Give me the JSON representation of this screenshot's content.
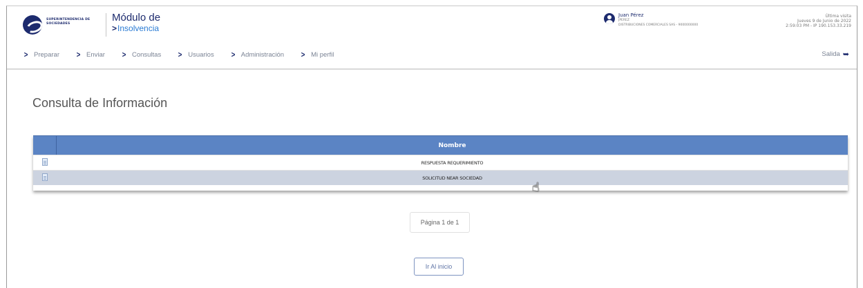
{
  "header": {
    "org_name": "SUPERINTENDENCIA DE SOCIEDADES",
    "module_title": "Módulo de",
    "module_subtitle": "Insolvencia",
    "user": {
      "name": "Juan Pérez",
      "role": "JPEREZ",
      "company": "DISTRIBUCIONES COMERCIALES SAS - 9000000000"
    },
    "last_visit": {
      "title": "Última visita",
      "date": "Jueves 9 de Junio de 2022",
      "time_ip": "2:59:03 PM - IP 190.153.33.219"
    }
  },
  "nav": {
    "items": [
      {
        "label": "Preparar",
        "icon": "chevron-right-icon"
      },
      {
        "label": "Enviar",
        "icon": "chevron-right-icon"
      },
      {
        "label": "Consultas",
        "icon": "chevron-right-icon"
      },
      {
        "label": "Usuarios",
        "icon": "chevron-right-icon"
      },
      {
        "label": "Administración",
        "icon": "chevron-right-icon"
      },
      {
        "label": "Mi perfil",
        "icon": "chevron-right-icon"
      }
    ],
    "logout_label": "Salida",
    "logout_icon": "sign-out-icon"
  },
  "main": {
    "page_title": "Consulta de Información",
    "table": {
      "header_name": "Nombre",
      "rows": [
        {
          "name": "RESPUESTA REQUERIMIENTO",
          "icon": "document-icon"
        },
        {
          "name": "SOLICITUD NEAR SOCIEDAD",
          "icon": "document-icon"
        }
      ]
    },
    "pager_text": "Página 1 de 1",
    "home_button": "Ir Al inicio"
  },
  "colors": {
    "brand_navy": "#1d2b6e",
    "table_header": "#5b84c4",
    "row_alt": "#ccd3e0",
    "accent_blue": "#2a7bd4"
  }
}
